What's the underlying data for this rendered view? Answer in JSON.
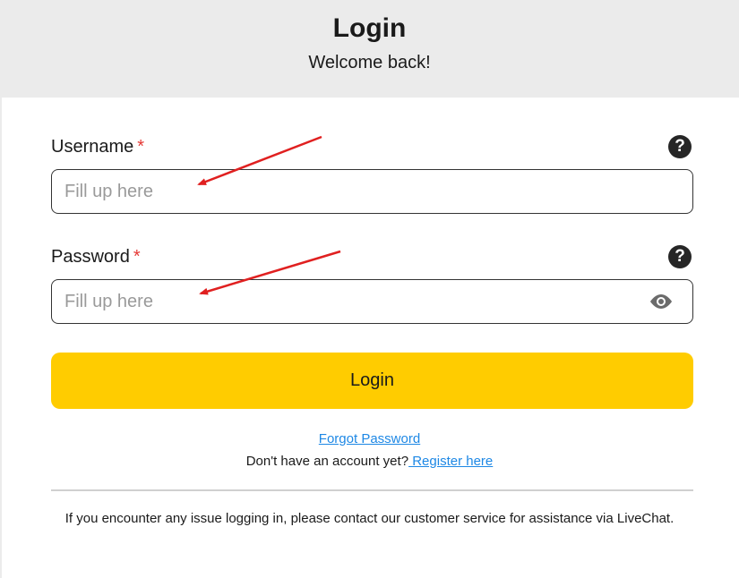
{
  "header": {
    "title": "Login",
    "subtitle": "Welcome back!"
  },
  "form": {
    "username": {
      "label": "Username",
      "required_mark": "*",
      "placeholder": "Fill up here",
      "value": "",
      "help_icon": "question-circle-icon"
    },
    "password": {
      "label": "Password",
      "required_mark": "*",
      "placeholder": "Fill up here",
      "value": "",
      "help_icon": "question-circle-icon",
      "toggle_icon": "eye-icon"
    },
    "submit_label": "Login"
  },
  "links": {
    "forgot_password": "Forgot Password",
    "no_account_text": "Don't have an account yet?",
    "register": " Register here"
  },
  "footer_note": "If you encounter any issue logging in, please contact our customer service for assistance via LiveChat.",
  "colors": {
    "accent": "#ffcc00",
    "link": "#1e88e5",
    "required": "#e53935",
    "header_bg": "#ebebeb",
    "annotation_arrow": "#e02020"
  }
}
